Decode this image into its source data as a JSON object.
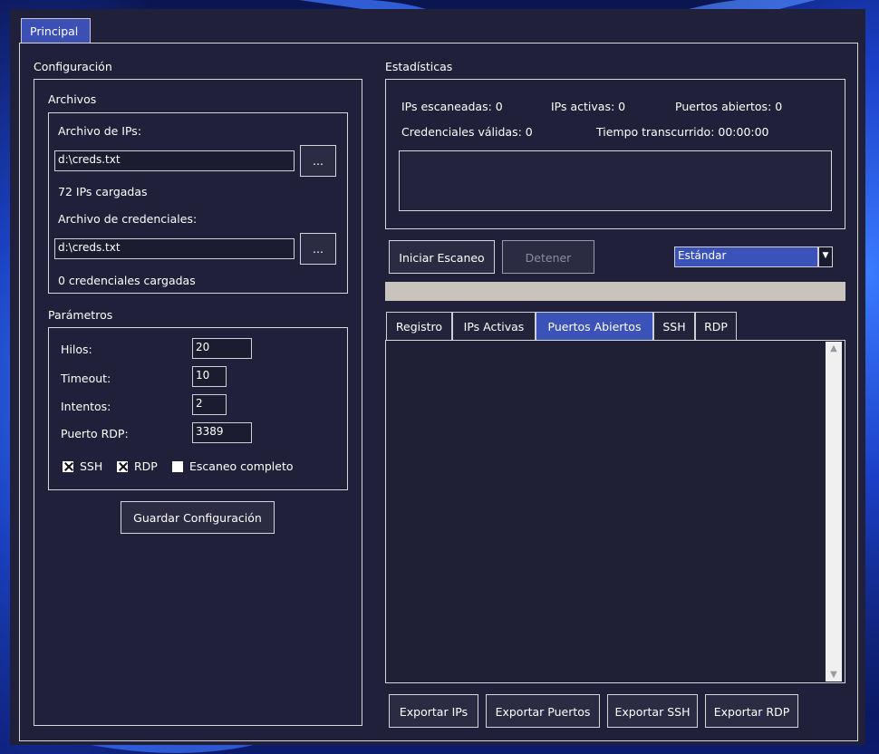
{
  "tabs": {
    "main": "Principal"
  },
  "config": {
    "title": "Configuración",
    "files": {
      "title": "Archivos",
      "ips_label": "Archivo de IPs:",
      "ips_value": "d:\\creds.txt",
      "ips_loaded": "72 IPs cargadas",
      "creds_label": "Archivo de credenciales:",
      "creds_value": "d:\\creds.txt",
      "creds_loaded": "0 credenciales cargadas",
      "browse_label": "..."
    },
    "params": {
      "title": "Parámetros",
      "threads_label": "Hilos:",
      "threads_value": "20",
      "timeout_label": "Timeout:",
      "timeout_value": "10",
      "attempts_label": "Intentos:",
      "attempts_value": "2",
      "rdp_port_label": "Puerto RDP:",
      "rdp_port_value": "3389",
      "ssh_label": "SSH",
      "ssh_checked": true,
      "rdp_label": "RDP",
      "rdp_checked": true,
      "full_scan_label": "Escaneo completo",
      "full_scan_checked": false
    },
    "save_label": "Guardar Configuración"
  },
  "stats": {
    "title": "Estadísticas",
    "ips_scanned": "IPs escaneadas: 0",
    "ips_active": "IPs activas: 0",
    "ports_open": "Puertos abiertos: 0",
    "creds_valid": "Credenciales válidas: 0",
    "elapsed": "Tiempo transcurrido: 00:00:00"
  },
  "controls": {
    "start_label": "Iniciar Escaneo",
    "stop_label": "Detener",
    "mode_value": "Estándar",
    "progress": 0
  },
  "results": {
    "tabs": [
      "Registro",
      "IPs Activas",
      "Puertos Abiertos",
      "SSH",
      "RDP"
    ],
    "active_tab": "Puertos Abiertos"
  },
  "export": {
    "ips": "Exportar IPs",
    "ports": "Exportar Puertos",
    "ssh": "Exportar SSH",
    "rdp": "Exportar RDP"
  },
  "colors": {
    "window_bg": "#20203a",
    "accent": "#3b52b8",
    "progress_track": "#c9c3bd"
  }
}
